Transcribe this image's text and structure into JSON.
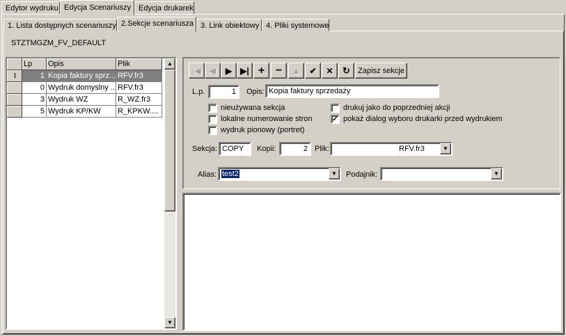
{
  "top_tabs": [
    {
      "label": "Edytor wydruku",
      "underline": "E"
    },
    {
      "label": "Edycja Scenariuszy",
      "underline": "S"
    },
    {
      "label": "Edycja drukarek",
      "underline": "d"
    }
  ],
  "sub_tabs": [
    {
      "label": "1. Lista dostępnych scenariuszy"
    },
    {
      "label": "2.Sekcje scenariusza"
    },
    {
      "label": "3. Link obiektowy"
    },
    {
      "label": "4. Pliki systemowe"
    }
  ],
  "scenario_name": "STZTMGZM_FV_DEFAULT",
  "grid": {
    "columns": [
      "Lp",
      "Opis",
      "Plik"
    ],
    "rows": [
      {
        "lp": "1",
        "opis": "Kopia faktury sprz...",
        "plik": "RFV.fr3",
        "selected": true
      },
      {
        "lp": "0",
        "opis": "Wydruk domyslny ...",
        "plik": "RFV.fr3"
      },
      {
        "lp": "3",
        "opis": "Wydruk WZ",
        "plik": "R_WZ.fr3"
      },
      {
        "lp": "5",
        "opis": "Wydruk KP/KW",
        "plik": "R_KPKW...."
      }
    ],
    "row_indicator": "I"
  },
  "toolbar": {
    "first": "|◀",
    "prev": "◀",
    "next": "▶",
    "last": "▶|",
    "add": "+",
    "remove": "−",
    "edit": "▲",
    "post": "✔",
    "cancel": "✕",
    "refresh": "↻",
    "save_label": "Zapisz sekcje"
  },
  "form": {
    "lp_label": "L.p.",
    "lp_value": "1",
    "opis_label": "Opis:",
    "opis_value": "Kopia faktury sprzedaży",
    "checks": [
      {
        "label": "nieużywana sekcja",
        "checked": false
      },
      {
        "label": "lokalne numerowanie stron",
        "checked": false
      },
      {
        "label": "wydruk pionowy (portret)",
        "checked": false
      },
      {
        "label": "drukuj jako do poprzedniej akcji",
        "checked": false
      },
      {
        "label": "pokaż dialog wyboru drukarki przed wydrukiem",
        "checked": true
      }
    ],
    "sekcja_label": "Sekcja:",
    "sekcja_value": "COPY",
    "kopii_label": "Kopii:",
    "kopii_value": "2",
    "plik_label": "Plik:",
    "plik_value": "RFV.fr3",
    "alias_label": "Alias:",
    "alias_value": "test2",
    "podajnik_label": "Podajnik:",
    "podajnik_value": ""
  },
  "scroll": {
    "up": "▲",
    "down": "▼"
  }
}
